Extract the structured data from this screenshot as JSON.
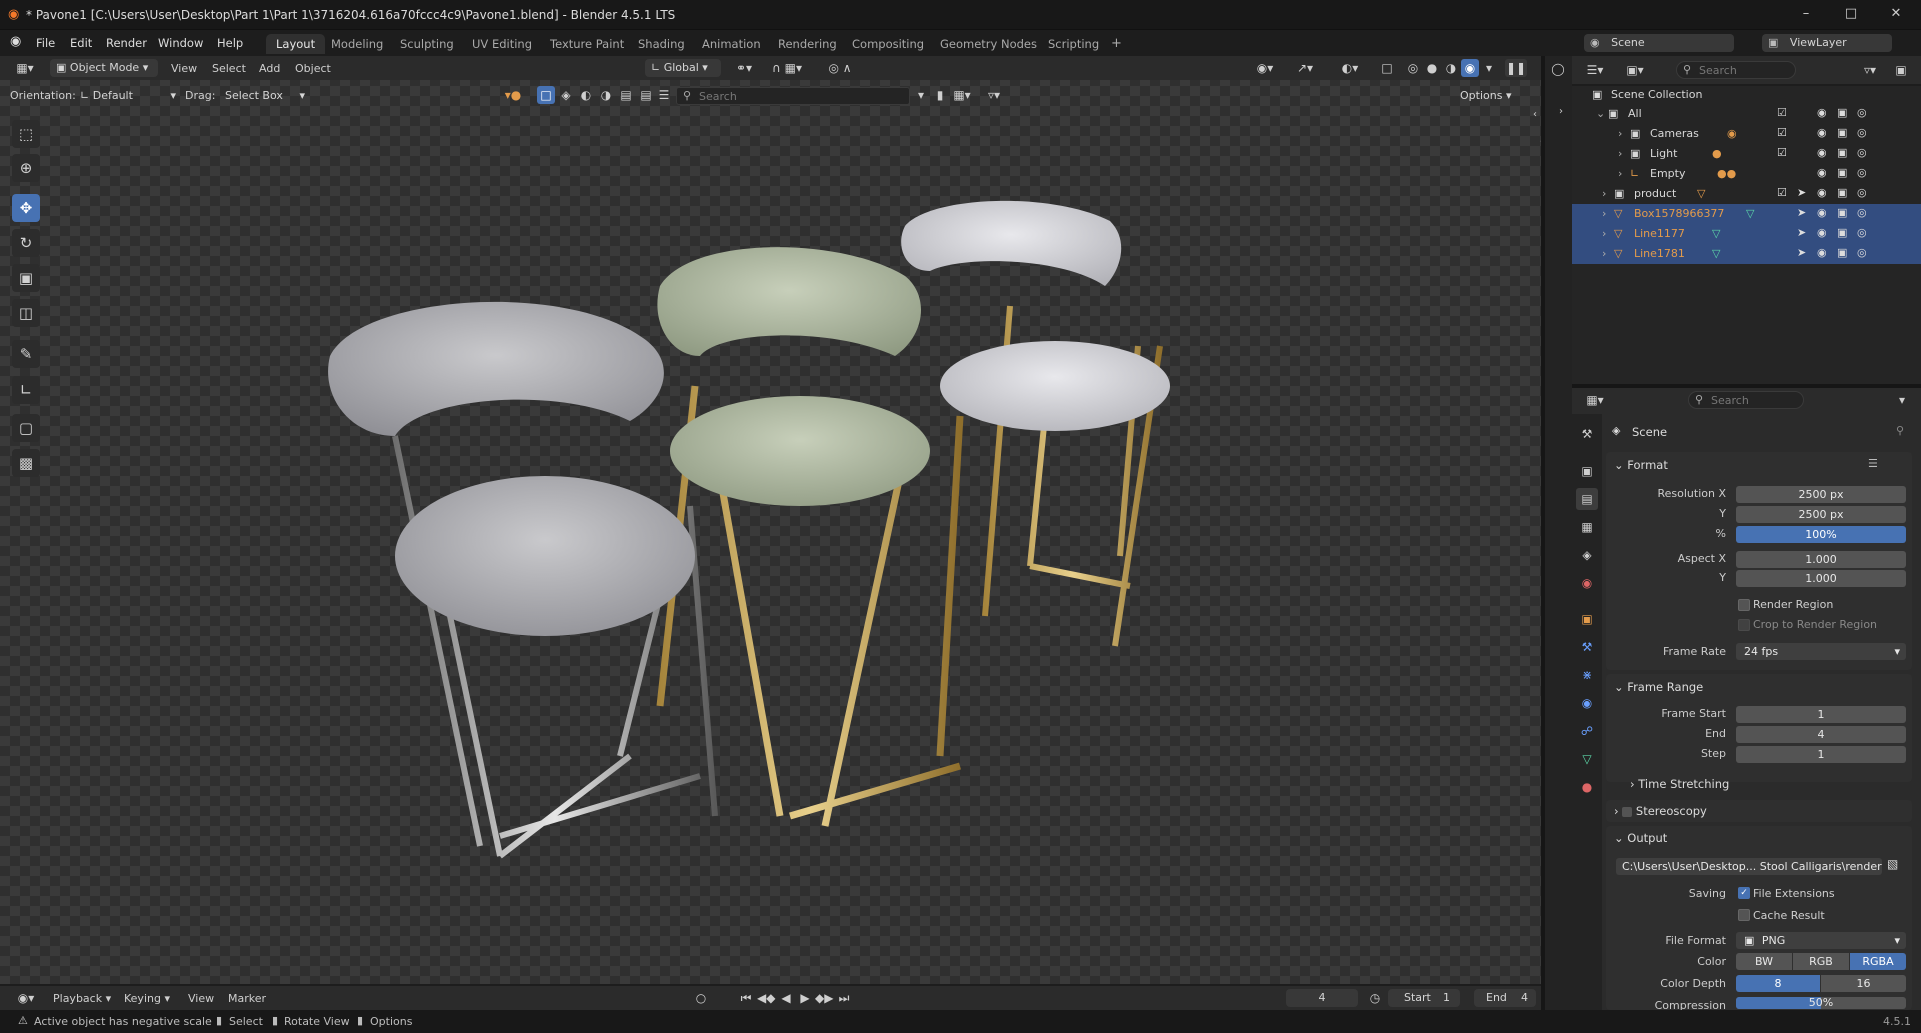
{
  "window": {
    "title": "* Pavone1 [C:\\Users\\User\\Desktop\\Part 1\\Part 1\\3716204.616a70fccc4c9\\Pavone1.blend] - Blender 4.5.1 LTS",
    "minimize": "–",
    "maximize": "□",
    "close": "✕"
  },
  "menu": [
    "File",
    "Edit",
    "Render",
    "Window",
    "Help"
  ],
  "workspaces": [
    "Layout",
    "Modeling",
    "Sculpting",
    "UV Editing",
    "Texture Paint",
    "Shading",
    "Animation",
    "Rendering",
    "Compositing",
    "Geometry Nodes",
    "Scripting"
  ],
  "top_right": {
    "scene": "Scene",
    "view_layer": "ViewLayer"
  },
  "viewport_header": {
    "mode": "Object Mode",
    "menus": [
      "View",
      "Select",
      "Add",
      "Object"
    ],
    "transform_orientation": "Global",
    "orientation_label": "Orientation:",
    "orientation_value": "Default",
    "drag_label": "Drag:",
    "drag_value": "Select Box",
    "search_placeholder": "Search",
    "options": "Options"
  },
  "toolbar_icons": [
    "select-box-icon",
    "cursor-icon",
    "move-icon",
    "rotate-icon",
    "scale-icon",
    "transform-icon",
    "annotate-icon",
    "measure-icon",
    "add-cube-icon",
    "add-object-icon"
  ],
  "outliner": {
    "search_placeholder": "Search",
    "root": "Scene Collection",
    "rows": [
      {
        "label": "All",
        "indent": 1,
        "color": "normal",
        "selected": false
      },
      {
        "label": "Cameras",
        "indent": 2,
        "color": "normal",
        "selected": false
      },
      {
        "label": "Light",
        "indent": 2,
        "color": "normal",
        "selected": false
      },
      {
        "label": "Empty",
        "indent": 2,
        "color": "normal",
        "selected": false
      },
      {
        "label": "product",
        "indent": 1,
        "color": "normal",
        "selected": false
      },
      {
        "label": "Box1578966377",
        "indent": 1,
        "color": "orange",
        "selected": true
      },
      {
        "label": "Line1177",
        "indent": 1,
        "color": "orange",
        "selected": true
      },
      {
        "label": "Line1781",
        "indent": 1,
        "color": "orange",
        "selected": true
      }
    ]
  },
  "properties": {
    "search_placeholder": "Search",
    "context": "Scene",
    "format": {
      "title": "Format",
      "resolution_x_label": "Resolution X",
      "resolution_x": "2500 px",
      "resolution_y_label": "Y",
      "resolution_y": "2500 px",
      "percent_label": "%",
      "percent": "100%",
      "aspect_x_label": "Aspect X",
      "aspect_x": "1.000",
      "aspect_y_label": "Y",
      "aspect_y": "1.000",
      "render_region": "Render Region",
      "crop_region": "Crop to Render Region",
      "frame_rate_label": "Frame Rate",
      "frame_rate": "24 fps"
    },
    "frame_range": {
      "title": "Frame Range",
      "start_label": "Frame Start",
      "start": "1",
      "end_label": "End",
      "end": "4",
      "step_label": "Step",
      "step": "1"
    },
    "time_stretching": "Time Stretching",
    "stereoscopy": "Stereoscopy",
    "output": {
      "title": "Output",
      "path": "C:\\Users\\User\\Desktop... Stool Calligaris\\render",
      "saving_label": "Saving",
      "file_extensions": "File Extensions",
      "cache_result": "Cache Result",
      "file_format_label": "File Format",
      "file_format": "PNG",
      "color_label": "Color",
      "color_options": [
        "BW",
        "RGB",
        "RGBA"
      ],
      "color_selected": "RGBA",
      "depth_label": "Color Depth",
      "depth_options": [
        "8",
        "16"
      ],
      "depth_selected": "8",
      "compression_label": "Compression",
      "compression": "50%"
    }
  },
  "timeline": {
    "menus": [
      "Playback",
      "Keying",
      "View",
      "Marker"
    ],
    "current_frame": "4",
    "start_label": "Start",
    "start": "1",
    "end_label": "End",
    "end": "4"
  },
  "statusbar": {
    "warning": "Active object has negative scale",
    "select": "Select",
    "rotate_view": "Rotate View",
    "options": "Options",
    "version": "4.5.1"
  },
  "colors": {
    "accent": "#4772b3",
    "selection_row": "#334d80",
    "object_orange": "#e39b4b"
  }
}
